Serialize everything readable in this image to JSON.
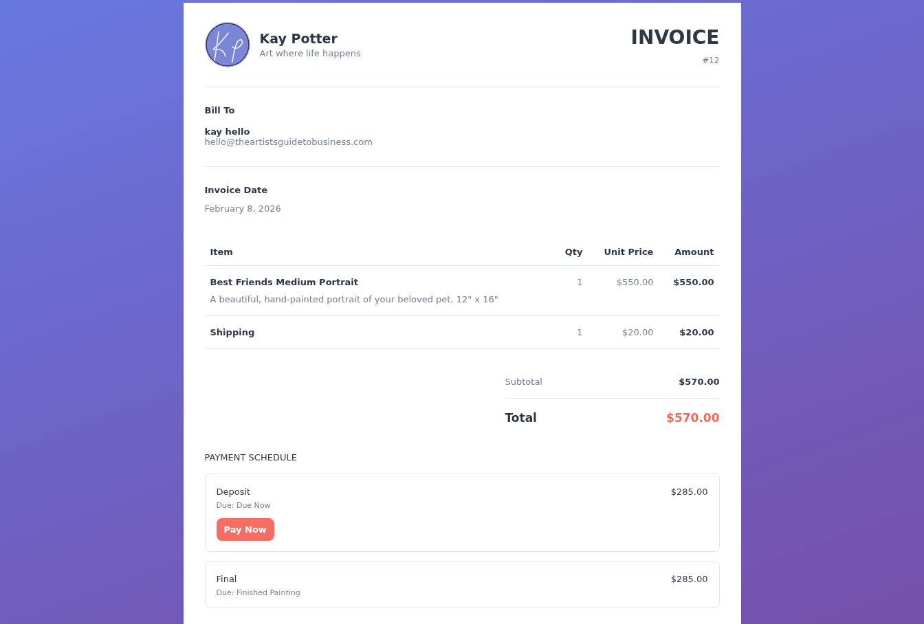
{
  "business": {
    "name": "Kay Potter",
    "tagline": "Art where life happens"
  },
  "invoice": {
    "title": "INVOICE",
    "number": "#12"
  },
  "bill_to": {
    "heading": "Bill To",
    "name": "kay hello",
    "email": "hello@theartistsguidetobusiness.com"
  },
  "invoice_date": {
    "heading": "Invoice Date",
    "value": "February 8, 2026"
  },
  "table": {
    "columns": [
      "Item",
      "Qty",
      "Unit Price",
      "Amount"
    ],
    "rows": [
      {
        "item": "Best Friends Medium Portrait",
        "description": "A beautiful, hand-painted portrait of your beloved pet, 12\" x 16\"",
        "qty": "1",
        "unit_price": "$550.00",
        "amount": "$550.00"
      },
      {
        "item": "Shipping",
        "qty": "1",
        "unit_price": "$20.00",
        "amount": "$20.00"
      }
    ]
  },
  "totals": {
    "subtotal_label": "Subtotal",
    "subtotal": "$570.00",
    "total_label": "Total",
    "total": "$570.00"
  },
  "payment_schedule": {
    "heading": "PAYMENT SCHEDULE",
    "payments": [
      {
        "name": "Deposit",
        "due": "Due: Due Now",
        "amount": "$285.00",
        "action": "Pay Now"
      },
      {
        "name": "Final",
        "due": "Due: Finished Painting",
        "amount": "$285.00"
      }
    ]
  }
}
